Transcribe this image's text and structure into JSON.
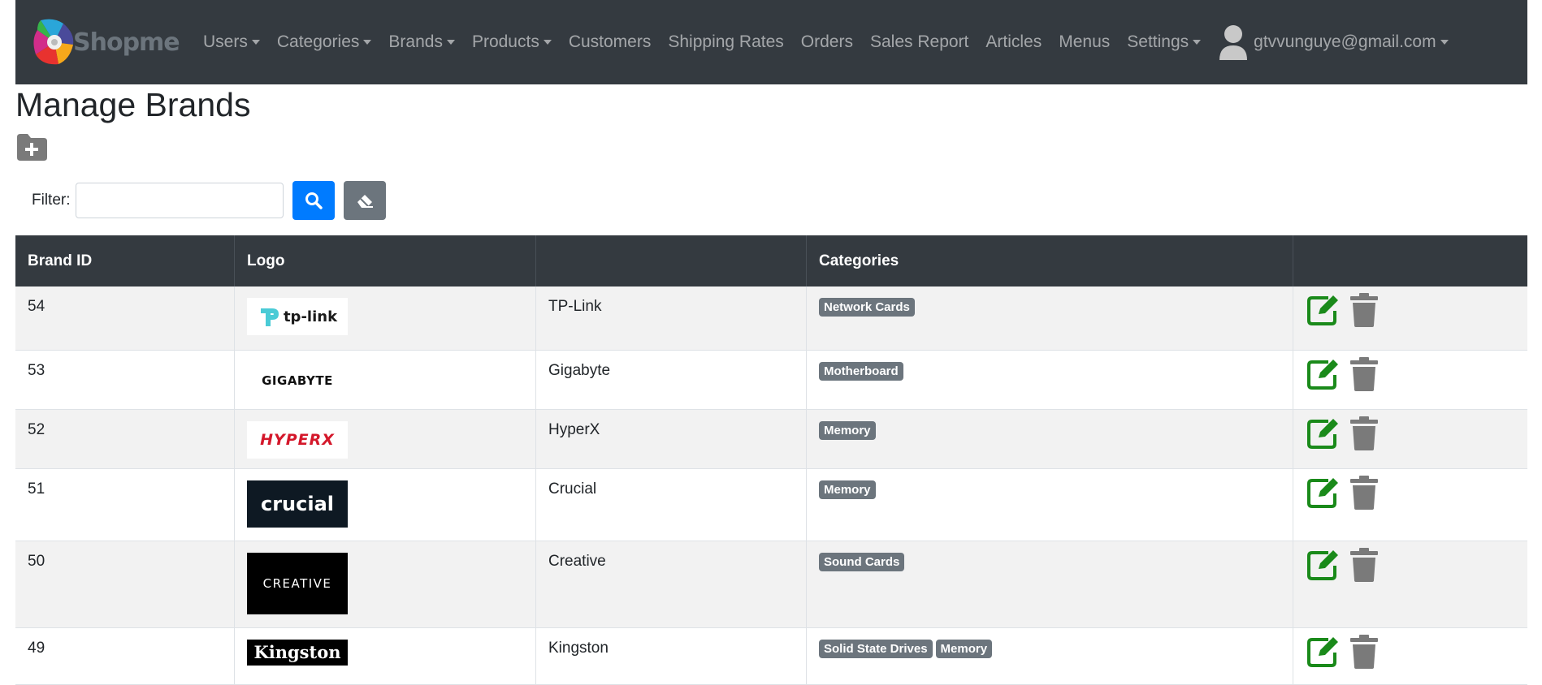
{
  "navbar": {
    "brand": "Shopme",
    "menu": [
      {
        "label": "Users",
        "dropdown": true
      },
      {
        "label": "Categories",
        "dropdown": true
      },
      {
        "label": "Brands",
        "dropdown": true
      },
      {
        "label": "Products",
        "dropdown": true
      },
      {
        "label": "Customers",
        "dropdown": false
      },
      {
        "label": "Shipping Rates",
        "dropdown": false
      },
      {
        "label": "Orders",
        "dropdown": false
      },
      {
        "label": "Sales Report",
        "dropdown": false
      },
      {
        "label": "Articles",
        "dropdown": false
      },
      {
        "label": "Menus",
        "dropdown": false
      },
      {
        "label": "Settings",
        "dropdown": true
      }
    ],
    "user_email": "gtvvunguye@gmail.com"
  },
  "page": {
    "title": "Manage Brands",
    "filter_label": "Filter:",
    "filter_value": ""
  },
  "table": {
    "headers": [
      "Brand ID",
      "Logo",
      "",
      "Categories",
      ""
    ],
    "rows": [
      {
        "id": "54",
        "logo": "tp-link",
        "name": "TP-Link",
        "categories": [
          "Network Cards"
        ]
      },
      {
        "id": "53",
        "logo": "GIGABYTE",
        "name": "Gigabyte",
        "categories": [
          "Motherboard"
        ]
      },
      {
        "id": "52",
        "logo": "HYPERX",
        "name": "HyperX",
        "categories": [
          "Memory"
        ]
      },
      {
        "id": "51",
        "logo": "crucial",
        "name": "Crucial",
        "categories": [
          "Memory"
        ]
      },
      {
        "id": "50",
        "logo": "CREATIVE",
        "name": "Creative",
        "categories": [
          "Sound Cards"
        ]
      },
      {
        "id": "49",
        "logo": "Kingston",
        "name": "Kingston",
        "categories": [
          "Solid State Drives",
          "Memory"
        ]
      }
    ]
  },
  "colors": {
    "navbar": "#343a40",
    "edit_icon": "#1a8a1a",
    "delete_icon": "#7a7a7a",
    "primary": "#007bff",
    "badge": "#6c757d"
  },
  "icons": {
    "add": "folder-plus-icon",
    "search": "search-icon",
    "clear": "eraser-icon",
    "edit": "edit-icon",
    "delete": "trash-icon",
    "user": "user-icon"
  }
}
